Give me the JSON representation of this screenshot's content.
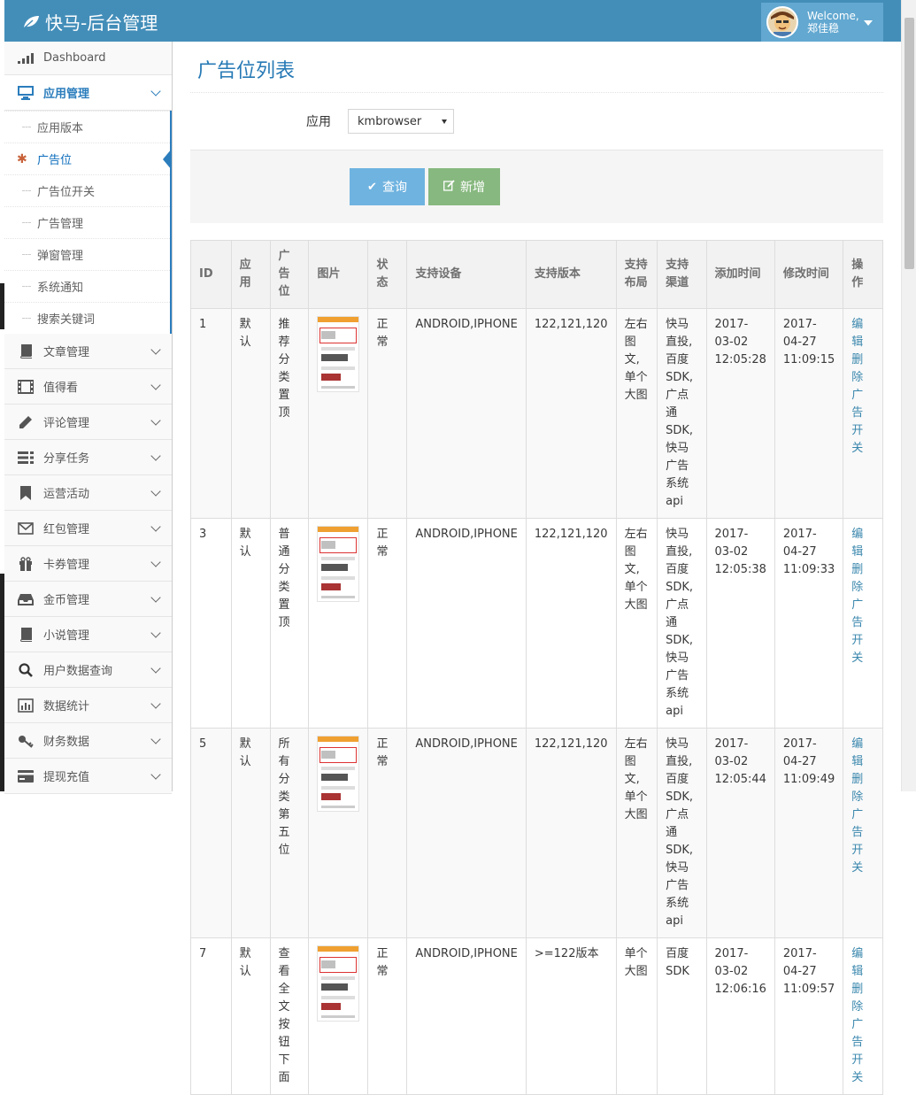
{
  "header": {
    "brand": "快马-后台管理",
    "welcome": "Welcome,",
    "username": "郑佳稳"
  },
  "sidebar": {
    "dashboard": "Dashboard",
    "open_group": "应用管理",
    "sub_items": [
      "应用版本",
      "广告位",
      "广告位开关",
      "广告管理",
      "弹窗管理",
      "系统通知",
      "搜索关键词"
    ],
    "groups": [
      {
        "label": "文章管理",
        "icon": "book-icon"
      },
      {
        "label": "值得看",
        "icon": "film-icon"
      },
      {
        "label": "评论管理",
        "icon": "pencil-icon"
      },
      {
        "label": "分享任务",
        "icon": "list-icon"
      },
      {
        "label": "运营活动",
        "icon": "bookmark-icon"
      },
      {
        "label": "红包管理",
        "icon": "envelope-icon"
      },
      {
        "label": "卡券管理",
        "icon": "gift-icon"
      },
      {
        "label": "金币管理",
        "icon": "inbox-icon"
      },
      {
        "label": "小说管理",
        "icon": "book-icon"
      },
      {
        "label": "用户数据查询",
        "icon": "search-icon"
      },
      {
        "label": "数据统计",
        "icon": "bar-chart-icon"
      },
      {
        "label": "财务数据",
        "icon": "key-icon"
      },
      {
        "label": "提现充值",
        "icon": "credit-card-icon"
      }
    ]
  },
  "main": {
    "title": "广告位列表",
    "filter_label": "应用",
    "filter_value": "kmbrowser",
    "query_label": "查询",
    "add_label": "新增"
  },
  "table": {
    "headers": [
      "ID",
      "应用",
      "广告位",
      "图片",
      "状态",
      "支持设备",
      "支持版本",
      "支持布局",
      "支持渠道",
      "添加时间",
      "修改时间",
      "操作"
    ],
    "rows": [
      {
        "id": "1",
        "app": "默认",
        "slot": "推荐分类置顶",
        "status": "正常",
        "devices": "ANDROID,IPHONE",
        "versions": "122,121,120",
        "layout": "左右图文,单个大图",
        "channels": "快马直投,百度SDK,广点通SDK,快马广告系统api",
        "added": "2017-03-02 12:05:28",
        "modified": "2017-04-27 11:09:15"
      },
      {
        "id": "3",
        "app": "默认",
        "slot": "普通分类置顶",
        "status": "正常",
        "devices": "ANDROID,IPHONE",
        "versions": "122,121,120",
        "layout": "左右图文,单个大图",
        "channels": "快马直投,百度SDK,广点通SDK,快马广告系统api",
        "added": "2017-03-02 12:05:38",
        "modified": "2017-04-27 11:09:33"
      },
      {
        "id": "5",
        "app": "默认",
        "slot": "所有分类第五位",
        "status": "正常",
        "devices": "ANDROID,IPHONE",
        "versions": "122,121,120",
        "layout": "左右图文,单个大图",
        "channels": "快马直投,百度SDK,广点通SDK,快马广告系统api",
        "added": "2017-03-02 12:05:44",
        "modified": "2017-04-27 11:09:49"
      },
      {
        "id": "7",
        "app": "默认",
        "slot": "查看全文按钮下面",
        "status": "正常",
        "devices": "ANDROID,IPHONE",
        "versions": ">=122版本",
        "layout": "单个大图",
        "channels": "百度SDK",
        "added": "2017-03-02 12:06:16",
        "modified": "2017-04-27 11:09:57"
      }
    ],
    "ops": [
      "编辑",
      "删除",
      "广告开关"
    ]
  }
}
